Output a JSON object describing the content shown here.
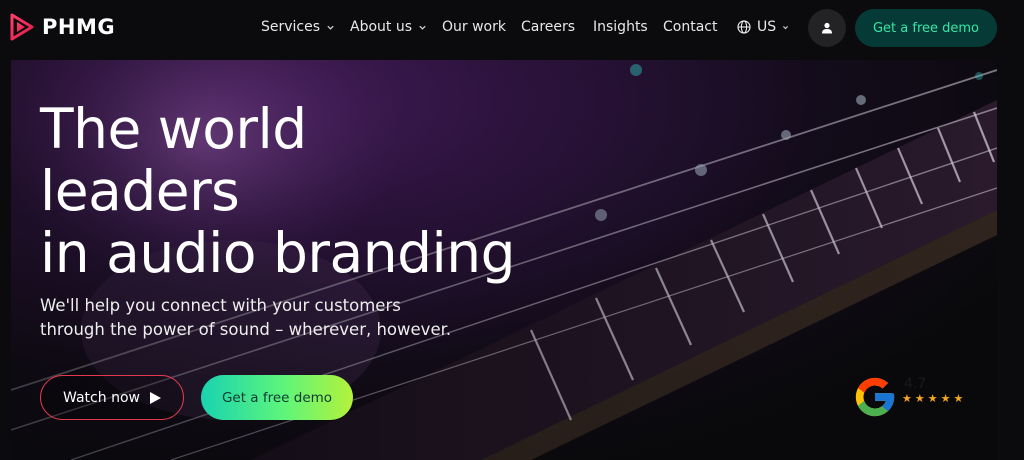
{
  "brand": {
    "name": "PHMG",
    "logo_icon": "phmg-logo-mark"
  },
  "nav": {
    "items": [
      {
        "label": "Services",
        "has_dropdown": true
      },
      {
        "label": "About us",
        "has_dropdown": true
      },
      {
        "label": "Our work",
        "has_dropdown": false
      },
      {
        "label": "Careers",
        "has_dropdown": false
      },
      {
        "label": "Insights",
        "has_dropdown": false
      },
      {
        "label": "Contact",
        "has_dropdown": false
      }
    ],
    "region": {
      "label": "US",
      "icon": "globe-icon"
    },
    "account_icon": "user-icon",
    "cta_label": "Get a free demo"
  },
  "hero": {
    "headline": [
      "The world",
      "leaders",
      "in audio branding"
    ],
    "subtitle": [
      "We'll help you connect with your customers",
      "through the power of sound – wherever, however."
    ],
    "watch_label": "Watch now",
    "demo_label": "Get a free demo"
  },
  "rating": {
    "provider_icon": "google-g-icon",
    "value": "4.7",
    "stars": "★★★★★",
    "star_count": 5
  },
  "colors": {
    "background": "#0b0b0d",
    "nav_cta_bg": "#063a36",
    "nav_cta_text": "#39e6a6",
    "watch_border": "#e3394f",
    "demo_gradient_start": "#19d3b0",
    "demo_gradient_end": "#b4f23a",
    "star": "#f5a623"
  }
}
